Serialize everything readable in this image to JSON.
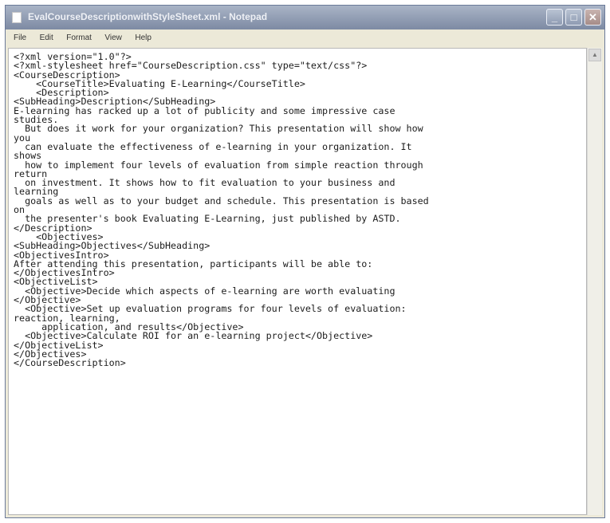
{
  "window": {
    "title": "EvalCourseDescriptionwithStyleSheet.xml - Notepad",
    "min_glyph": "_",
    "max_glyph": "□",
    "close_glyph": "✕"
  },
  "menu": {
    "file": "File",
    "edit": "Edit",
    "format": "Format",
    "view": "View",
    "help": "Help"
  },
  "document": {
    "text": "<?xml version=\"1.0\"?>\n<?xml-stylesheet href=\"CourseDescription.css\" type=\"text/css\"?>\n<CourseDescription>\n    <CourseTitle>Evaluating E-Learning</CourseTitle>\n    <Description>\n<SubHeading>Description</SubHeading>\nE-learning has racked up a lot of publicity and some impressive case\nstudies.\n  But does it work for your organization? This presentation will show how\nyou\n  can evaluate the effectiveness of e-learning in your organization. It\nshows\n  how to implement four levels of evaluation from simple reaction through\nreturn\n  on investment. It shows how to fit evaluation to your business and\nlearning\n  goals as well as to your budget and schedule. This presentation is based\non\n  the presenter's book Evaluating E-Learning, just published by ASTD.\n</Description>\n    <Objectives>\n<SubHeading>Objectives</SubHeading>\n<ObjectivesIntro>\nAfter attending this presentation, participants will be able to:\n</ObjectivesIntro>\n<ObjectiveList>\n  <Objective>Decide which aspects of e-learning are worth evaluating\n</Objective>\n  <Objective>Set up evaluation programs for four levels of evaluation:\nreaction, learning,\n     application, and results</Objective>\n  <Objective>Calculate ROI for an e-learning project</Objective>\n</ObjectiveList>\n</Objectives>\n</CourseDescription>"
  },
  "colors": {
    "titlebar": "#8e9bb2",
    "frame": "#ece9d8",
    "editor_bg": "#ffffff"
  }
}
